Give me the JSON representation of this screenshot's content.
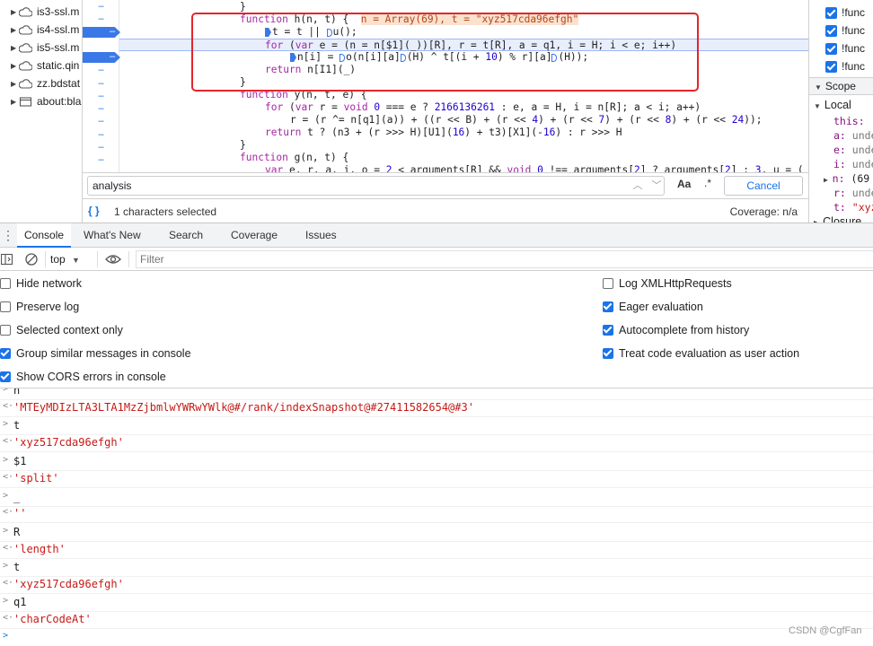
{
  "file_tree": {
    "items": [
      {
        "label": "is3-ssl.m",
        "icon": "cloud-icon"
      },
      {
        "label": "is4-ssl.m",
        "icon": "cloud-icon"
      },
      {
        "label": "is5-ssl.m",
        "icon": "cloud-icon"
      },
      {
        "label": "static.qin",
        "icon": "cloud-icon"
      },
      {
        "label": "zz.bdstat",
        "icon": "cloud-icon"
      },
      {
        "label": "about:bla",
        "icon": "window-icon"
      }
    ]
  },
  "editor": {
    "inline_values": "n = Array(69), t = \"xyz517cda96efgh\"",
    "lines": [
      "}",
      "function h(n, t) {",
      "t = t || u();",
      "for (var e = (n = n[$1](_))[R], r = t[R], a = q1, i = H; i < e; i++)",
      "n[i] = o(n[i][a](H) ^ t[(i + 10) % r][a](H));",
      "return n[I1](_)",
      "}",
      "function y(n, t, e) {",
      "for (var r = void 0 === e ? 2166136261 : e, a = H, i = n[R]; a < i; a++)",
      "r = (r ^= n[q1](a)) + ((r << B) + (r << 4) + (r << 7) + (r << 8) + (r << 24));",
      "return t ? (n3 + (r >>> H)[U1](16) + t3)[X1](-16) : r >>> H",
      "}",
      "function g(n, t) {",
      "var e, r, a, i, o = 2 < arguments[R] && void 0 !== arguments[2] ? arguments[2] : 3, u = ("
    ]
  },
  "search": {
    "value": "analysis",
    "case_label": "Aa",
    "regex_label": ".*",
    "cancel_label": "Cancel"
  },
  "status": {
    "braces": "{ }",
    "selection": "1 characters selected",
    "coverage": "Coverage: n/a"
  },
  "breakpoints_panel": {
    "items": [
      {
        "label": "!func",
        "checked": true
      },
      {
        "label": "!func",
        "checked": true
      },
      {
        "label": "!func",
        "checked": true
      },
      {
        "label": "!func",
        "checked": true
      }
    ]
  },
  "scope": {
    "title": "Scope",
    "local_label": "Local",
    "vars": [
      {
        "name": "this:",
        "value": "("
      },
      {
        "name": "a:",
        "value": "unde"
      },
      {
        "name": "e:",
        "value": "unde"
      },
      {
        "name": "i:",
        "value": "unde"
      },
      {
        "name": "n:",
        "value": "(69"
      },
      {
        "name": "r:",
        "value": "unde"
      },
      {
        "name": "t:",
        "value": "\"xyz"
      }
    ],
    "closure_label": "Closure"
  },
  "drawer": {
    "tabs": [
      "Console",
      "What's New",
      "Search",
      "Coverage",
      "Issues"
    ],
    "active_tab": "Console"
  },
  "console_toolbar": {
    "context": "top",
    "filter_placeholder": "Filter"
  },
  "settings": {
    "left": [
      {
        "label": "Hide network",
        "checked": false
      },
      {
        "label": "Preserve log",
        "checked": false
      },
      {
        "label": "Selected context only",
        "checked": false
      },
      {
        "label": "Group similar messages in console",
        "checked": true
      },
      {
        "label": "Show CORS errors in console",
        "checked": true
      }
    ],
    "right": [
      {
        "label": "Log XMLHttpRequests",
        "checked": false
      },
      {
        "label": "Eager evaluation",
        "checked": true
      },
      {
        "label": "Autocomplete from history",
        "checked": true
      },
      {
        "label": "Treat code evaluation as user action",
        "checked": true
      }
    ]
  },
  "console_log": [
    {
      "kind": "input",
      "text": "n"
    },
    {
      "kind": "output",
      "text": "'MTEyMDIzLTA3LTA1MzZjbmlwYWRwYWlk@#/rank/indexSnapshot@#27411582654@#3'"
    },
    {
      "kind": "input",
      "text": "t"
    },
    {
      "kind": "output",
      "text": "'xyz517cda96efgh'"
    },
    {
      "kind": "input",
      "text": "$1"
    },
    {
      "kind": "output",
      "text": "'split'"
    },
    {
      "kind": "input",
      "text": "_"
    },
    {
      "kind": "output",
      "text": "''"
    },
    {
      "kind": "input",
      "text": "R"
    },
    {
      "kind": "output",
      "text": "'length'"
    },
    {
      "kind": "input",
      "text": "t"
    },
    {
      "kind": "output",
      "text": "'xyz517cda96efgh'"
    },
    {
      "kind": "input",
      "text": "q1"
    },
    {
      "kind": "output",
      "text": "'charCodeAt'"
    },
    {
      "kind": "prompt",
      "text": ""
    }
  ],
  "watermark": "CSDN @CgfFan",
  "colors": {
    "accent": "#1a73e8",
    "highlight_box": "#e3262a",
    "string": "#c41a16",
    "keyword": "#a626a4"
  }
}
